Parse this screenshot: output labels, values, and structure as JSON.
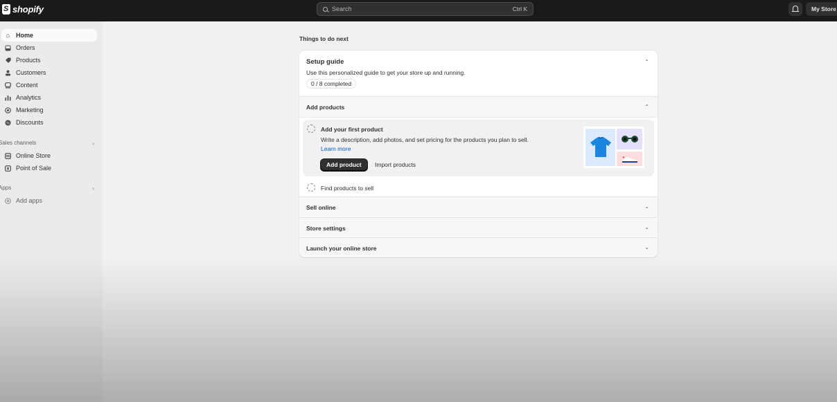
{
  "topbar": {
    "logo_text": "shopify",
    "search_placeholder": "Search",
    "search_shortcut": "Ctrl K",
    "store_name": "My Store"
  },
  "sidebar": {
    "items": [
      {
        "label": "Home",
        "icon": "home-icon",
        "active": true
      },
      {
        "label": "Orders",
        "icon": "inbox-icon"
      },
      {
        "label": "Products",
        "icon": "tag-icon"
      },
      {
        "label": "Customers",
        "icon": "person-icon"
      },
      {
        "label": "Content",
        "icon": "image-icon"
      },
      {
        "label": "Analytics",
        "icon": "bar-chart-icon"
      },
      {
        "label": "Marketing",
        "icon": "target-icon"
      },
      {
        "label": "Discounts",
        "icon": "discount-icon"
      }
    ],
    "sales_channels_title": "Sales channels",
    "sales_channels": [
      {
        "label": "Online Store",
        "icon": "store-icon"
      },
      {
        "label": "Point of Sale",
        "icon": "pos-icon"
      }
    ],
    "apps_title": "Apps",
    "add_apps_label": "Add apps"
  },
  "main": {
    "title": "Things to do next",
    "setup_guide": {
      "title": "Setup guide",
      "description": "Use this personalized guide to get your store up and running.",
      "progress_label": "0 / 8 completed",
      "progress": {
        "completed": 0,
        "total": 8
      }
    },
    "sections": [
      {
        "label": "Add products",
        "expanded": true
      },
      {
        "label": "Sell online",
        "expanded": false
      },
      {
        "label": "Store settings",
        "expanded": false
      },
      {
        "label": "Launch your online store",
        "expanded": false
      }
    ],
    "tasks": {
      "first_product": {
        "title": "Add your first product",
        "description": "Write a description, add photos, and set pricing for the products you plan to sell.",
        "link_label": "Learn more",
        "primary_button": "Add product",
        "secondary_button": "Import products"
      },
      "find_products": {
        "title": "Find products to sell"
      }
    }
  }
}
